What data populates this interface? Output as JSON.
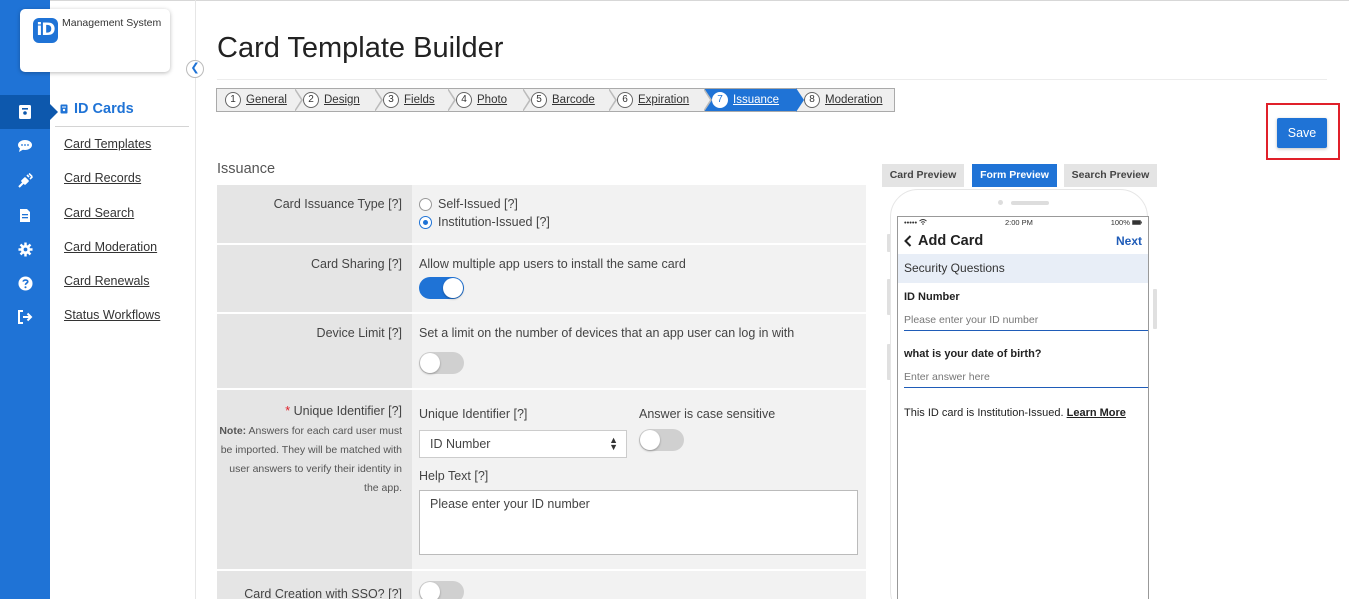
{
  "app": {
    "logo_badge": "iD",
    "logo_text": "Management System"
  },
  "rail_icons": [
    "id-card-icon",
    "chat-icon",
    "plug-icon",
    "document-icon",
    "gear-icon",
    "help-icon",
    "logout-icon"
  ],
  "sidebar": {
    "heading": "ID Cards",
    "items": [
      "Card Templates",
      "Card Records",
      "Card Search",
      "Card Moderation",
      "Card Renewals",
      "Status Workflows"
    ]
  },
  "page": {
    "title": "Card Template Builder",
    "save_label": "Save",
    "section_label": "Issuance"
  },
  "steps": [
    {
      "num": "1",
      "label": "General"
    },
    {
      "num": "2",
      "label": "Design"
    },
    {
      "num": "3",
      "label": "Fields"
    },
    {
      "num": "4",
      "label": "Photo"
    },
    {
      "num": "5",
      "label": "Barcode"
    },
    {
      "num": "6",
      "label": "Expiration"
    },
    {
      "num": "7",
      "label": "Issuance",
      "active": true
    },
    {
      "num": "8",
      "label": "Moderation"
    }
  ],
  "form": {
    "issuance_type": {
      "label": "Card Issuance Type [?]",
      "options": [
        "Self-Issued [?]",
        "Institution-Issued [?]"
      ],
      "selected": "Institution-Issued [?]"
    },
    "sharing": {
      "label": "Card Sharing [?]",
      "text": "Allow multiple app users to install the same card",
      "enabled": true
    },
    "device_limit": {
      "label": "Device Limit [?]",
      "text": "Set a limit on the number of devices that an app user can log in with",
      "enabled": false
    },
    "unique_id": {
      "required_mark": "*",
      "label": "Unique Identifier [?]",
      "note_bold": "Note:",
      "note_text": "Answers for each card user must be imported. They will be matched with user answers to verify their identity in the app.",
      "select_label": "Unique Identifier [?]",
      "select_value": "ID Number",
      "case_label": "Answer is case sensitive",
      "case_enabled": false,
      "help_label": "Help Text [?]",
      "help_value": "Please enter your ID number"
    },
    "sso": {
      "label": "Card Creation with SSO? [?]",
      "enabled": false
    }
  },
  "preview": {
    "tabs": [
      "Card Preview",
      "Form Preview",
      "Search Preview"
    ],
    "active_tab": "Form Preview",
    "status_left": "•••••",
    "status_time": "2:00 PM",
    "status_right": "100%",
    "nav_title": "Add Card",
    "nav_next": "Next",
    "section": "Security Questions",
    "field1_label": "ID Number",
    "field1_placeholder": "Please enter your ID number",
    "field2_label": "what is your date of birth?",
    "field2_placeholder": "Enter answer here",
    "footer_text": "This ID card is Institution-Issued.",
    "footer_link": "Learn More"
  },
  "colors": {
    "brand": "#1f73d6",
    "highlight": "#e0202a"
  }
}
